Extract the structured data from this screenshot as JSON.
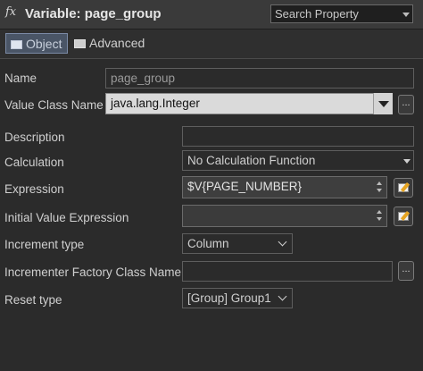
{
  "titlebar": {
    "fx_symbol": "fx",
    "title": "Variable: page_group",
    "search_placeholder": "Search Property"
  },
  "tabs": [
    {
      "label": "Object",
      "active": true
    },
    {
      "label": "Advanced",
      "active": false
    }
  ],
  "form": {
    "name": {
      "label": "Name",
      "value": "page_group"
    },
    "value_class": {
      "label": "Value Class Name",
      "value": "java.lang.Integer",
      "button": "..."
    },
    "description": {
      "label": "Description",
      "value": ""
    },
    "calculation": {
      "label": "Calculation",
      "value": "No Calculation Function"
    },
    "expression": {
      "label": "Expression",
      "value": "$V{PAGE_NUMBER}"
    },
    "initial_value": {
      "label": "Initial Value Expression",
      "value": ""
    },
    "increment_type": {
      "label": "Increment type",
      "value": "Column"
    },
    "incrementer_factory": {
      "label": "Incrementer Factory Class Name",
      "value": "",
      "button": "..."
    },
    "reset_type": {
      "label": "Reset type",
      "value": "[Group] Group1"
    }
  }
}
